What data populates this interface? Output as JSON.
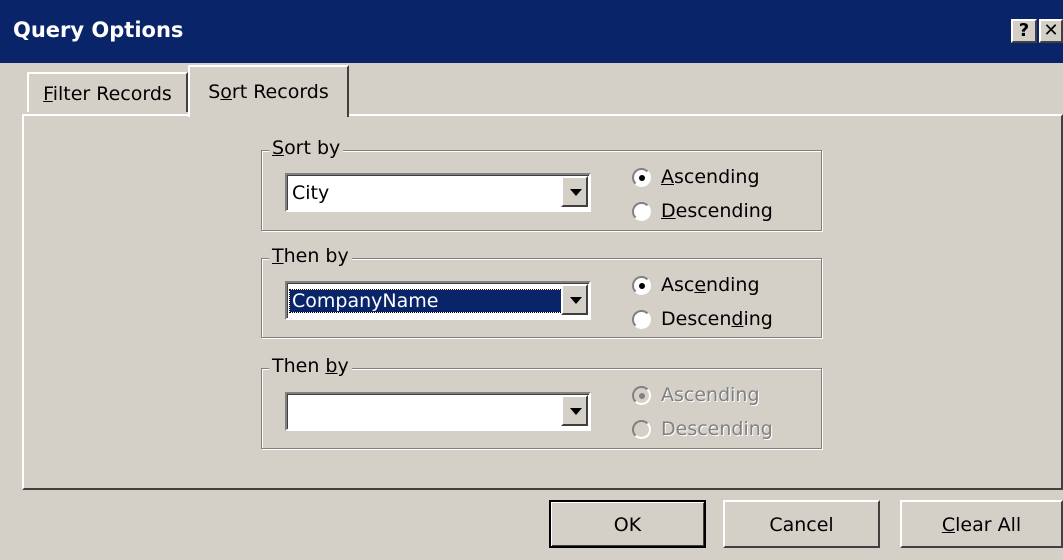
{
  "window": {
    "title": "Query Options",
    "help_button": "?",
    "close_button": "✕"
  },
  "tabs": [
    {
      "label_prefix": "",
      "label_accel": "F",
      "label_rest": "ilter Records",
      "active": false
    },
    {
      "label_prefix": "S",
      "label_accel": "o",
      "label_rest": "rt Records",
      "active": true
    }
  ],
  "groups": [
    {
      "legend_prefix": "",
      "legend_accel": "S",
      "legend_rest": "ort by",
      "field_value": "City",
      "ascending": {
        "prefix": "",
        "accel": "A",
        "rest": "scending",
        "checked": true
      },
      "descending": {
        "prefix": "",
        "accel": "D",
        "rest": "escending",
        "checked": false
      },
      "enabled": true
    },
    {
      "legend_prefix": "",
      "legend_accel": "T",
      "legend_rest": "hen by",
      "field_value": "CompanyName",
      "ascending": {
        "prefix": "Asc",
        "accel": "e",
        "rest": "nding",
        "checked": true
      },
      "descending": {
        "prefix": "Descen",
        "accel": "d",
        "rest": "ing",
        "checked": false
      },
      "enabled": true
    },
    {
      "legend_prefix": "Then ",
      "legend_accel": "b",
      "legend_rest": "y",
      "field_value": "",
      "ascending": {
        "prefix": "Ascending",
        "accel": "",
        "rest": "",
        "checked": true
      },
      "descending": {
        "prefix": "Descending",
        "accel": "",
        "rest": "",
        "checked": false
      },
      "enabled": false
    }
  ],
  "buttons": {
    "ok": "OK",
    "cancel": "Cancel",
    "clear_all_accel": "C",
    "clear_all_rest": "lear All"
  }
}
